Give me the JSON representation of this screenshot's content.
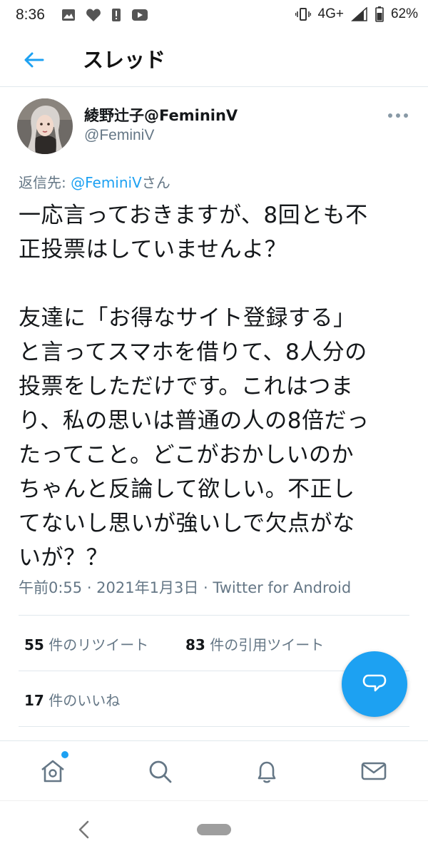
{
  "status_bar": {
    "time": "8:36",
    "network": "4G+",
    "battery": "62%",
    "left_icons": [
      "gallery-icon",
      "heart-icon",
      "alert-icon",
      "youtube-icon"
    ],
    "right_icons": [
      "vibrate-icon",
      "signal-icon",
      "battery-icon"
    ]
  },
  "header": {
    "title": "スレッド",
    "back_icon": "arrow-left-icon"
  },
  "tweet": {
    "author_name": "綾野辻子@FemininV",
    "author_handle": "@FeminiV",
    "reply_prefix": "返信先: ",
    "reply_mention": "@FeminiV",
    "reply_suffix": "さん",
    "body": "一応言っておきますが、8回とも不\n正投票はしていませんよ？\n\n友達に「お得なサイト登録する」\nと言ってスマホを借りて、8人分の\n投票をしただけです。これはつま\nり、私の思いは普通の人の8倍だっ\nたってこと。どこがおかしいのか\nちゃんと反論して欲しい。不正し\nてないし思いが強いしで欠点がな\nいが？？",
    "timestamp": "午前0:55 · 2021年1月3日 · Twitter for Android"
  },
  "stats": {
    "retweets_count": "55",
    "retweets_label": " 件のリツイート",
    "quotes_count": "83",
    "quotes_label": " 件の引用ツイート",
    "likes_count": "17",
    "likes_label": " 件のいいね"
  },
  "colors": {
    "accent": "#1da1f2",
    "text_primary": "#14171a",
    "text_secondary": "#657786",
    "divider": "#e1e8ed"
  },
  "bottom_nav": {
    "items": [
      "home-icon",
      "search-icon",
      "notifications-icon",
      "messages-icon"
    ]
  },
  "fab": {
    "icon": "compose-reply-icon"
  }
}
